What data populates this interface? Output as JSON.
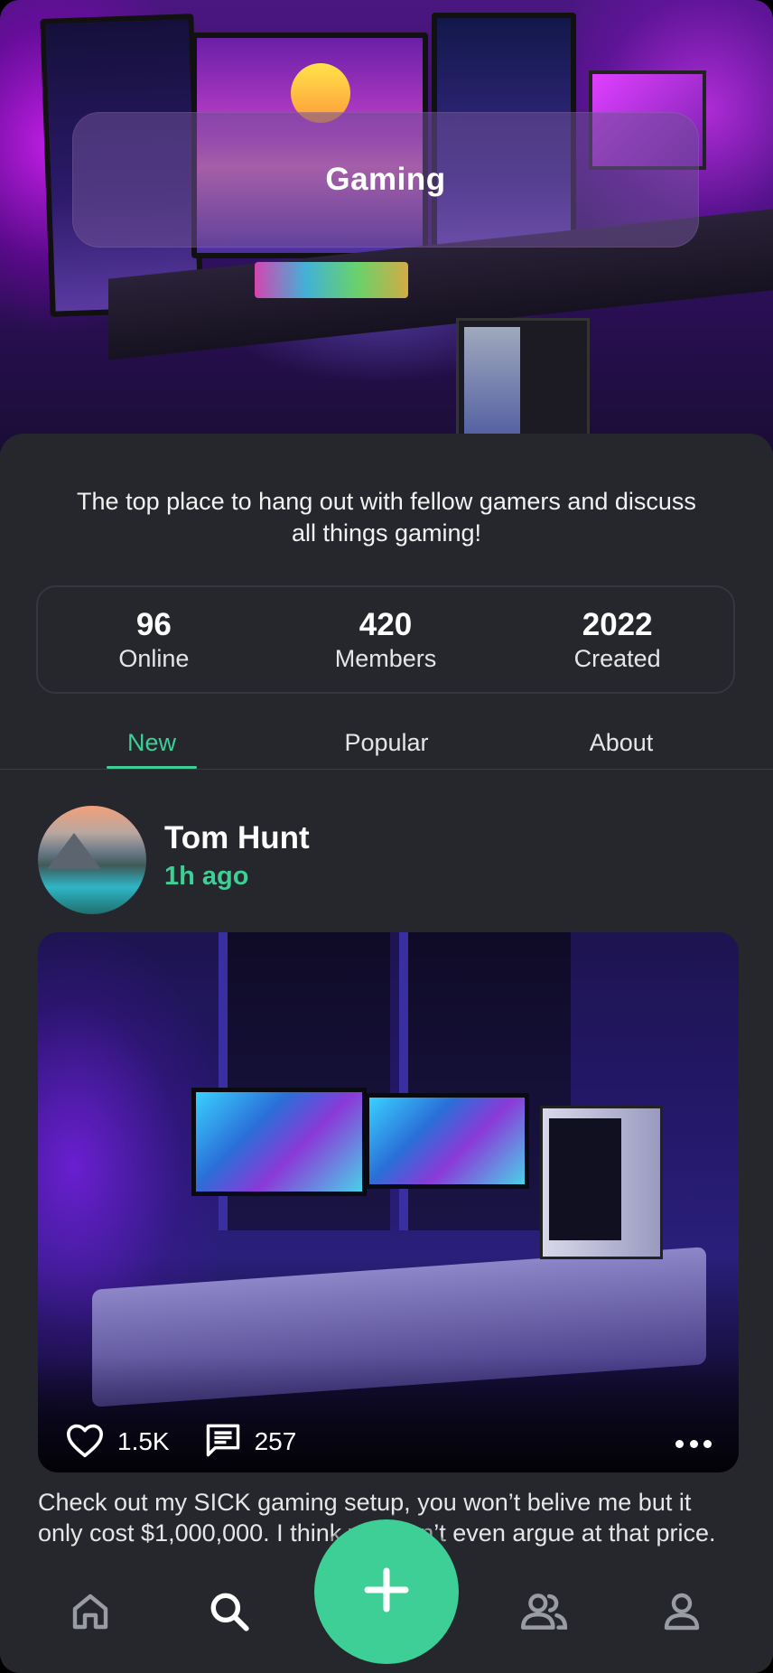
{
  "community": {
    "name": "Gaming",
    "description": "The top place to hang out with fellow gamers and discuss all things gaming!",
    "stats": [
      {
        "value": "96",
        "label": "Online"
      },
      {
        "value": "420",
        "label": "Members"
      },
      {
        "value": "2022",
        "label": "Created"
      }
    ]
  },
  "tabs": [
    {
      "label": "New",
      "active": true
    },
    {
      "label": "Popular",
      "active": false
    },
    {
      "label": "About",
      "active": false
    }
  ],
  "post": {
    "author": "Tom Hunt",
    "time": "1h ago",
    "likes": "1.5K",
    "comments": "257",
    "caption": "Check out my SICK gaming setup, you won’t belive me but it only cost $1,000,000. I think you can’t even argue at that price."
  },
  "nav": {
    "items": [
      "home-icon",
      "search-icon",
      "add-icon",
      "friends-icon",
      "profile-icon"
    ],
    "active": "search-icon"
  },
  "colors": {
    "accent": "#3ecf97",
    "background": "#25272c",
    "inactive_icon": "#9a9ca3"
  }
}
